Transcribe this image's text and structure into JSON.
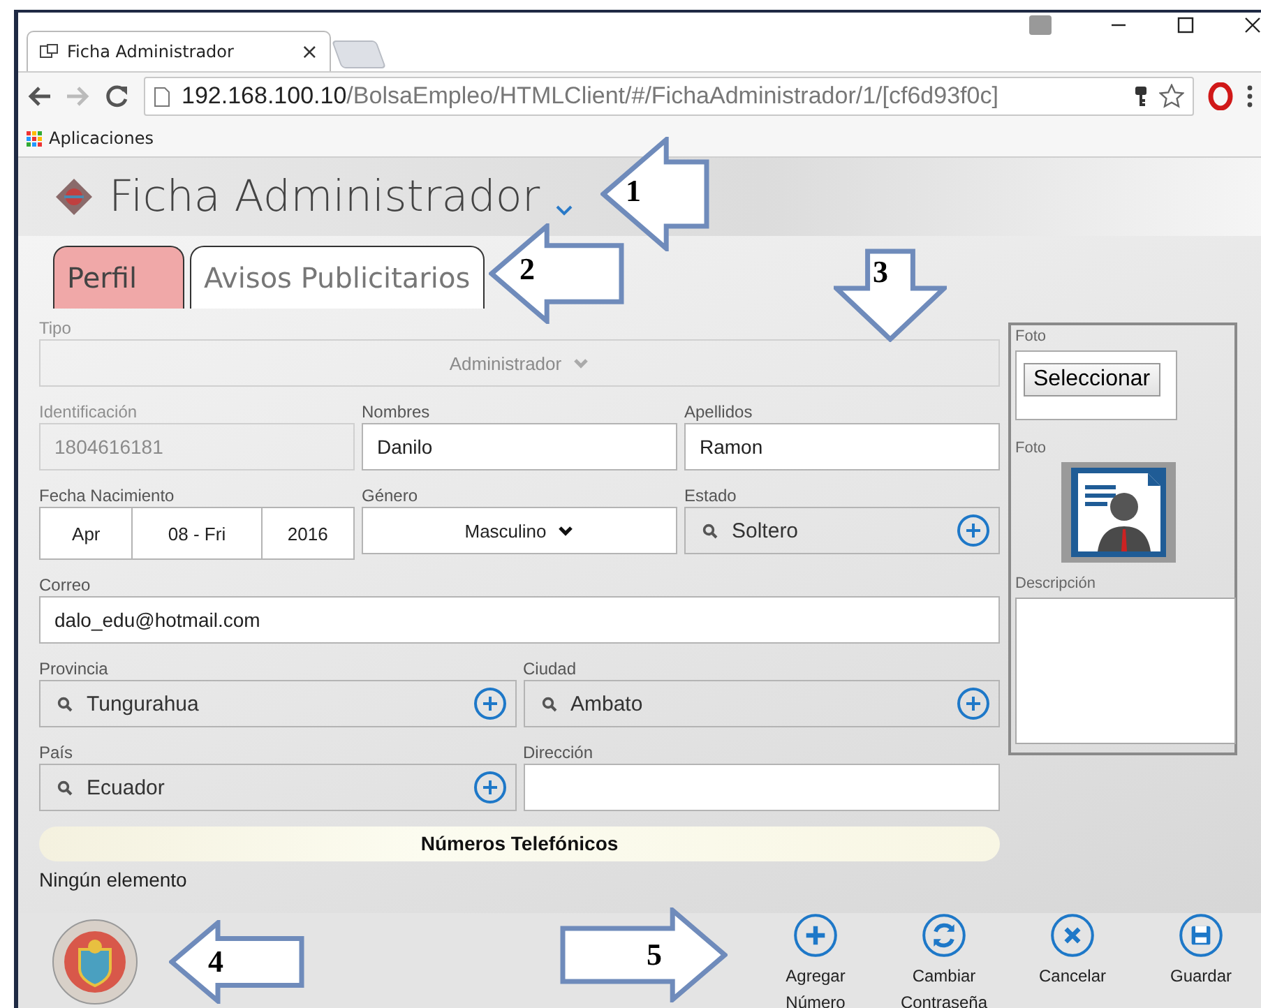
{
  "browser": {
    "tab_title": "Ficha Administrador",
    "tab_close": "×",
    "url_host": "192.168.100.10",
    "url_path": "/BolsaEmpleo/HTMLClient/#/FichaAdministrador/1/[cf6d93f0c]",
    "bookmarks": [
      {
        "label": "Aplicaciones"
      }
    ]
  },
  "page": {
    "title": "Ficha Administrador"
  },
  "tabs": [
    {
      "label": "Perfil",
      "selected": true
    },
    {
      "label": "Avisos Publicitarios",
      "selected": false
    }
  ],
  "form": {
    "rows": [
      [
        {
          "label": "Tipo",
          "kind": "select",
          "value": "Administrador",
          "disabled": true
        }
      ],
      [
        {
          "label": "Identificación",
          "kind": "text",
          "value": "1804616181",
          "disabled": true
        },
        {
          "label": "Nombres",
          "kind": "text",
          "value": "Danilo",
          "disabled": false
        },
        {
          "label": "Apellidos",
          "kind": "text",
          "value": "Ramon",
          "disabled": false
        }
      ],
      [
        {
          "label": "Fecha Nacimiento",
          "kind": "date",
          "parts": [
            "Apr",
            "08 - Fri",
            "2016"
          ],
          "disabled": false
        },
        {
          "label": "Género",
          "kind": "select",
          "value": "Masculino",
          "disabled": false
        },
        {
          "label": "Estado",
          "kind": "lookup",
          "value": "Soltero",
          "disabled": false
        }
      ],
      [
        {
          "label": "Correo",
          "kind": "text",
          "value": "dalo_edu@hotmail.com",
          "disabled": false
        }
      ],
      [
        {
          "label": "Provincia",
          "kind": "lookup",
          "value": "Tungurahua",
          "disabled": false
        },
        {
          "label": "Ciudad",
          "kind": "lookup",
          "value": "Ambato",
          "disabled": false
        }
      ],
      [
        {
          "label": "País",
          "kind": "lookup",
          "value": "Ecuador",
          "disabled": false
        },
        {
          "label": "Dirección",
          "kind": "text",
          "disabled": false
        }
      ]
    ]
  },
  "side_panel": {
    "upload_label": "Foto",
    "upload_button": "Seleccionar",
    "photo_label": "Foto",
    "description_label": "Descripción"
  },
  "phones": {
    "title": "Números Telefónicos",
    "empty_text": "Ningún elemento"
  },
  "footer": {
    "buttons": [
      {
        "label": "Agregar Número",
        "kind": "add"
      },
      {
        "label": "Cambiar Contraseña",
        "kind": "refresh"
      },
      {
        "label": "Cancelar",
        "kind": "cancel"
      },
      {
        "label": "Guardar",
        "kind": "save"
      }
    ]
  },
  "annotations": [
    {
      "number": "1",
      "kind": "left"
    },
    {
      "number": "2",
      "kind": "left"
    },
    {
      "number": "3",
      "kind": "down"
    },
    {
      "number": "4",
      "kind": "left"
    },
    {
      "number": "5",
      "kind": "right"
    }
  ]
}
